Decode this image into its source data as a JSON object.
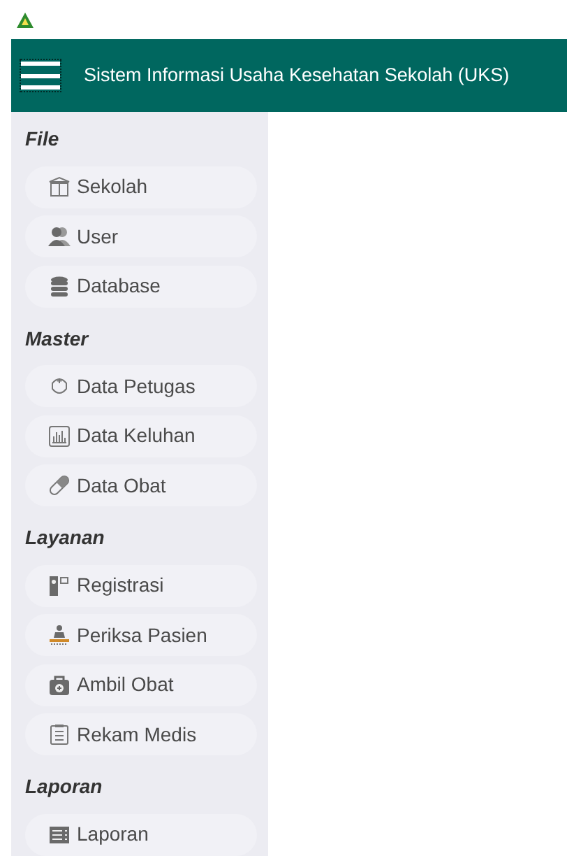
{
  "header": {
    "title": "Sistem Informasi Usaha Kesehatan Sekolah (UKS)"
  },
  "sidebar": {
    "sections": [
      {
        "title": "File",
        "items": [
          {
            "label": "Sekolah"
          },
          {
            "label": "User"
          },
          {
            "label": "Database"
          }
        ]
      },
      {
        "title": "Master",
        "items": [
          {
            "label": "Data Petugas"
          },
          {
            "label": "Data Keluhan"
          },
          {
            "label": "Data Obat"
          }
        ]
      },
      {
        "title": "Layanan",
        "items": [
          {
            "label": "Registrasi"
          },
          {
            "label": "Periksa Pasien"
          },
          {
            "label": "Ambil Obat"
          },
          {
            "label": "Rekam Medis"
          }
        ]
      },
      {
        "title": "Laporan",
        "items": [
          {
            "label": "Laporan"
          }
        ]
      }
    ]
  }
}
